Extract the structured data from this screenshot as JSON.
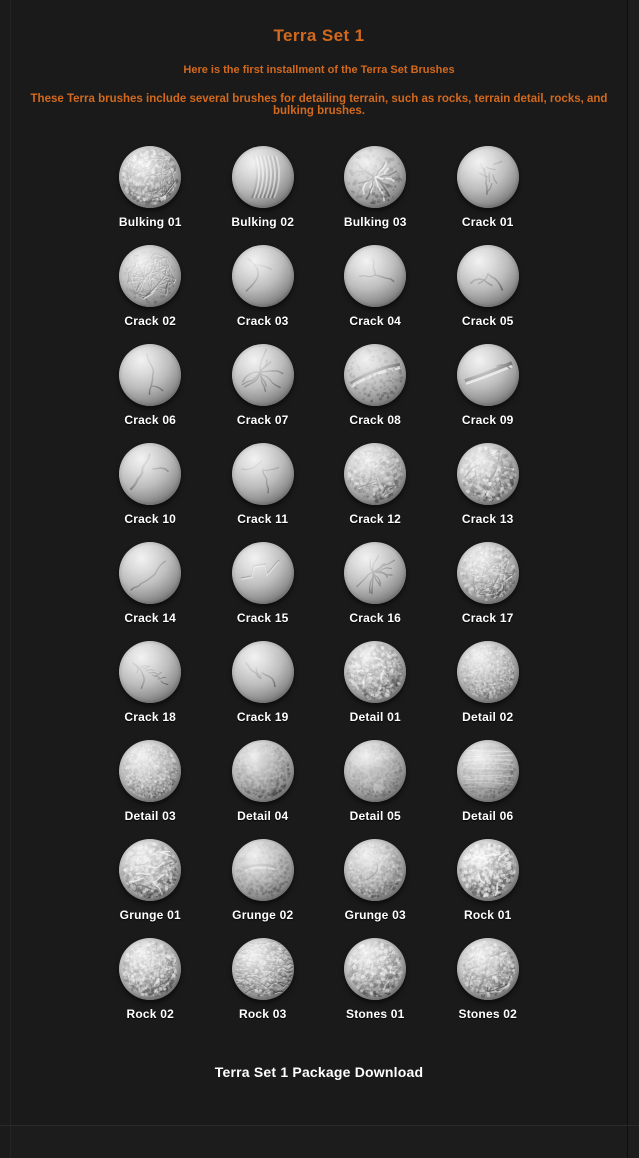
{
  "theme": {
    "page_background": "#1b1b1b",
    "content_background": "#1a1a1a",
    "accent_orange": "#d2691e",
    "label_color": "#ffffff",
    "divider_color": "#2b2b2b"
  },
  "header": {
    "title": "Terra Set 1",
    "subtitle_line1": "Here is the first installment of the Terra Set Brushes",
    "subtitle_line2": "These Terra brushes include several brushes for detailing terrain, such as rocks, terrain detail, rocks, and bulking brushes."
  },
  "grid": {
    "columns": 4,
    "rows": 9,
    "count": 36,
    "items": [
      {
        "label": "Bulking 01",
        "texture": "rough-crumble",
        "icon": "brush-sphere-preview-icon"
      },
      {
        "label": "Bulking 02",
        "texture": "soft-folds",
        "icon": "brush-sphere-preview-icon"
      },
      {
        "label": "Bulking 03",
        "texture": "jagged-burst",
        "icon": "brush-sphere-preview-icon"
      },
      {
        "label": "Crack 01",
        "texture": "branch-crack",
        "icon": "brush-sphere-preview-icon"
      },
      {
        "label": "Crack 02",
        "texture": "web-crackle",
        "icon": "brush-sphere-preview-icon"
      },
      {
        "label": "Crack 03",
        "texture": "single-diagonal-crack",
        "icon": "brush-sphere-preview-icon"
      },
      {
        "label": "Crack 04",
        "texture": "y-fork-crack",
        "icon": "brush-sphere-preview-icon"
      },
      {
        "label": "Crack 05",
        "texture": "arrow-crack",
        "icon": "brush-sphere-preview-icon"
      },
      {
        "label": "Crack 06",
        "texture": "vertical-wander-crack",
        "icon": "brush-sphere-preview-icon"
      },
      {
        "label": "Crack 07",
        "texture": "spike-cross-crack",
        "icon": "brush-sphere-preview-icon"
      },
      {
        "label": "Crack 08",
        "texture": "wide-gash",
        "icon": "brush-sphere-preview-icon"
      },
      {
        "label": "Crack 09",
        "texture": "deep-split",
        "icon": "brush-sphere-preview-icon"
      },
      {
        "label": "Crack 10",
        "texture": "zigzag-dark-crack",
        "icon": "brush-sphere-preview-icon"
      },
      {
        "label": "Crack 11",
        "texture": "thin-branch-crack",
        "icon": "brush-sphere-preview-icon"
      },
      {
        "label": "Crack 12",
        "texture": "patch-crackle",
        "icon": "brush-sphere-preview-icon"
      },
      {
        "label": "Crack 13",
        "texture": "island-crackle",
        "icon": "brush-sphere-preview-icon"
      },
      {
        "label": "Crack 14",
        "texture": "long-diagonal-crack",
        "icon": "brush-sphere-preview-icon"
      },
      {
        "label": "Crack 15",
        "texture": "step-crack",
        "icon": "brush-sphere-preview-icon"
      },
      {
        "label": "Crack 16",
        "texture": "starburst-crack",
        "icon": "brush-sphere-preview-icon"
      },
      {
        "label": "Crack 17",
        "texture": "map-crackle",
        "icon": "brush-sphere-preview-icon"
      },
      {
        "label": "Crack 18",
        "texture": "feather-crack",
        "icon": "brush-sphere-preview-icon"
      },
      {
        "label": "Crack 19",
        "texture": "lightning-crack",
        "icon": "brush-sphere-preview-icon"
      },
      {
        "label": "Detail 01",
        "texture": "eroded-ridges",
        "icon": "brush-sphere-preview-icon"
      },
      {
        "label": "Detail 02",
        "texture": "fine-grain",
        "icon": "brush-sphere-preview-icon"
      },
      {
        "label": "Detail 03",
        "texture": "even-noise",
        "icon": "brush-sphere-preview-icon"
      },
      {
        "label": "Detail 04",
        "texture": "patchy-noise",
        "icon": "brush-sphere-preview-icon"
      },
      {
        "label": "Detail 05",
        "texture": "mottled-noise",
        "icon": "brush-sphere-preview-icon"
      },
      {
        "label": "Detail 06",
        "texture": "streaked-noise",
        "icon": "brush-sphere-preview-icon"
      },
      {
        "label": "Grunge 01",
        "texture": "coarse-grunge",
        "icon": "brush-sphere-preview-icon"
      },
      {
        "label": "Grunge 02",
        "texture": "smear-grunge",
        "icon": "brush-sphere-preview-icon"
      },
      {
        "label": "Grunge 03",
        "texture": "speckle-grunge",
        "icon": "brush-sphere-preview-icon"
      },
      {
        "label": "Rock 01",
        "texture": "rock-chips",
        "icon": "brush-sphere-preview-icon"
      },
      {
        "label": "Rock 02",
        "texture": "rock-pebble",
        "icon": "brush-sphere-preview-icon"
      },
      {
        "label": "Rock 03",
        "texture": "rock-strata",
        "icon": "brush-sphere-preview-icon"
      },
      {
        "label": "Stones 01",
        "texture": "stone-cluster",
        "icon": "brush-sphere-preview-icon"
      },
      {
        "label": "Stones 02",
        "texture": "stone-mosaic",
        "icon": "brush-sphere-preview-icon"
      }
    ]
  },
  "footer": {
    "download_label": "Terra Set 1 Package Download"
  }
}
